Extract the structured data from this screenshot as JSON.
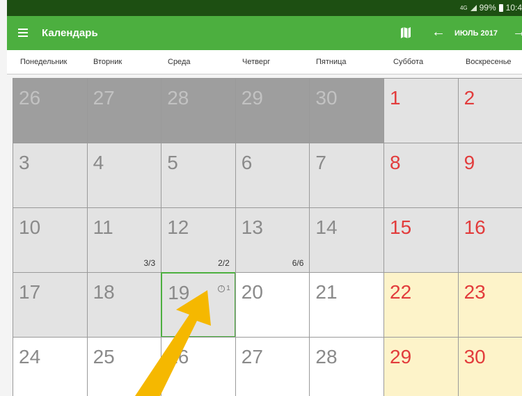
{
  "status_bar": {
    "network": "4G",
    "battery": "99%",
    "time": "10:4"
  },
  "app_bar": {
    "menu_icon": "hamburger-menu-icon",
    "title": "Календарь",
    "map_icon": "map-icon",
    "back_icon": "arrow-left-icon",
    "month": "ИЮЛЬ 2017",
    "forward_icon": "arrow-right-icon",
    "color": "#4caf3f"
  },
  "weekdays": [
    "Понедельник",
    "Вторник",
    "Среда",
    "Четверг",
    "Пятница",
    "Суббота",
    "Воскресенье"
  ],
  "days": [
    {
      "n": "26",
      "state": "prev"
    },
    {
      "n": "27",
      "state": "prev"
    },
    {
      "n": "28",
      "state": "prev"
    },
    {
      "n": "29",
      "state": "prev"
    },
    {
      "n": "30",
      "state": "prev"
    },
    {
      "n": "1",
      "state": "past",
      "weekend": true
    },
    {
      "n": "2",
      "state": "past",
      "weekend": true
    },
    {
      "n": "3",
      "state": "past"
    },
    {
      "n": "4",
      "state": "past"
    },
    {
      "n": "5",
      "state": "past"
    },
    {
      "n": "6",
      "state": "past"
    },
    {
      "n": "7",
      "state": "past"
    },
    {
      "n": "8",
      "state": "past",
      "weekend": true
    },
    {
      "n": "9",
      "state": "past",
      "weekend": true
    },
    {
      "n": "10",
      "state": "past"
    },
    {
      "n": "11",
      "state": "past",
      "count": "3/3"
    },
    {
      "n": "12",
      "state": "past",
      "count": "2/2"
    },
    {
      "n": "13",
      "state": "past",
      "count": "6/6"
    },
    {
      "n": "14",
      "state": "past"
    },
    {
      "n": "15",
      "state": "past",
      "weekend": true
    },
    {
      "n": "16",
      "state": "past",
      "weekend": true
    },
    {
      "n": "17",
      "state": "past"
    },
    {
      "n": "18",
      "state": "past"
    },
    {
      "n": "19",
      "state": "today",
      "alert": "1"
    },
    {
      "n": "20",
      "state": "future"
    },
    {
      "n": "21",
      "state": "future"
    },
    {
      "n": "22",
      "state": "wkfuture",
      "weekend": true
    },
    {
      "n": "23",
      "state": "wkfuture",
      "weekend": true
    },
    {
      "n": "24",
      "state": "future"
    },
    {
      "n": "25",
      "state": "future"
    },
    {
      "n": "26",
      "state": "future"
    },
    {
      "n": "27",
      "state": "future"
    },
    {
      "n": "28",
      "state": "future"
    },
    {
      "n": "29",
      "state": "wkfuture",
      "weekend": true
    },
    {
      "n": "30",
      "state": "wkfuture",
      "weekend": true
    }
  ],
  "overlay": {
    "icon": "pointer-arrow-icon",
    "color": "#f5b800"
  }
}
